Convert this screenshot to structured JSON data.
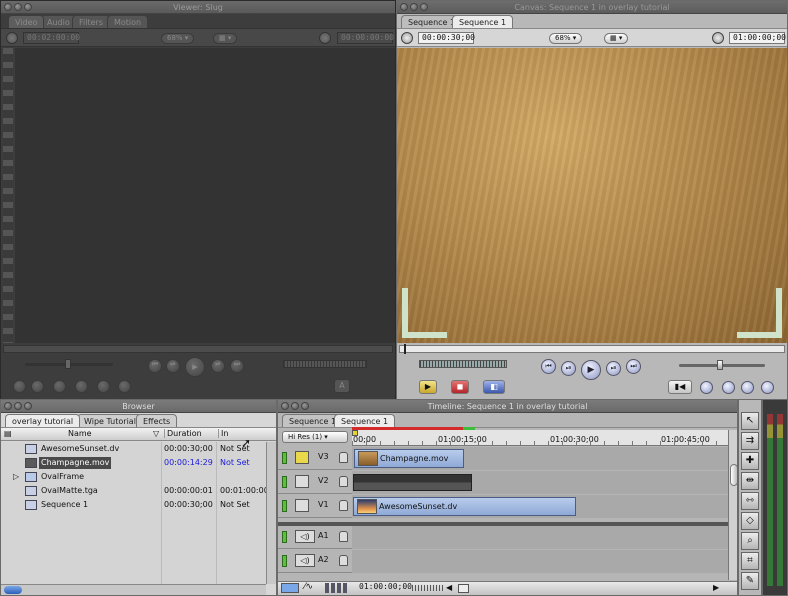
{
  "viewer": {
    "title": "Viewer: Slug",
    "tabs": [
      "Video",
      "Audio",
      "Filters",
      "Motion"
    ],
    "duration": "00:02:00:00",
    "zoom": "68%",
    "current": "00:00:00:00"
  },
  "canvas": {
    "title": "Canvas: Sequence 1 in overlay tutorial",
    "tabs": [
      "Sequence 1",
      "Sequence 1"
    ],
    "duration": "00:00:30;00",
    "zoom": "68%",
    "current": "01:00:00;00",
    "image_color": "#b58a4c"
  },
  "browser": {
    "title": "Browser",
    "tabs": [
      "overlay tutorial",
      "Wipe Tutorial",
      "Effects"
    ],
    "columns": {
      "name": "Name",
      "duration": "Duration",
      "in": "In"
    },
    "rows": [
      {
        "name": "AwesomeSunset.dv",
        "duration": "00:00:30;00",
        "in": "Not Set",
        "icon": "clip-icon",
        "selected": false
      },
      {
        "name": "Champagne.mov",
        "duration": "00:00:14:29",
        "in": "Not Set",
        "icon": "clip-icon",
        "selected": true
      },
      {
        "name": "OvalFrame",
        "duration": "",
        "in": "",
        "icon": "folder-icon",
        "selected": false
      },
      {
        "name": "OvalMatte.tga",
        "duration": "00:00:00:01",
        "in": "00:01:00:00",
        "icon": "still-icon",
        "selected": false
      },
      {
        "name": "Sequence 1",
        "duration": "00:00:30;00",
        "in": "Not Set",
        "icon": "sequence-icon",
        "selected": false
      }
    ]
  },
  "timeline": {
    "title": "Timeline: Sequence 1 in overlay tutorial",
    "tabs": [
      "Sequence 1",
      "Sequence 1"
    ],
    "res": "Hi Res (1)",
    "ruler": [
      "00;00",
      "01:00:15;00",
      "01:00:30;00",
      "01:00:45;00"
    ],
    "tracks": {
      "v3": "V3",
      "v2": "V2",
      "v1": "V1",
      "a1": "A1",
      "a2": "A2"
    },
    "clips": {
      "v3": "Champagne.mov",
      "v1": "AwesomeSunset.dv"
    },
    "current": "01:00:00;00"
  }
}
